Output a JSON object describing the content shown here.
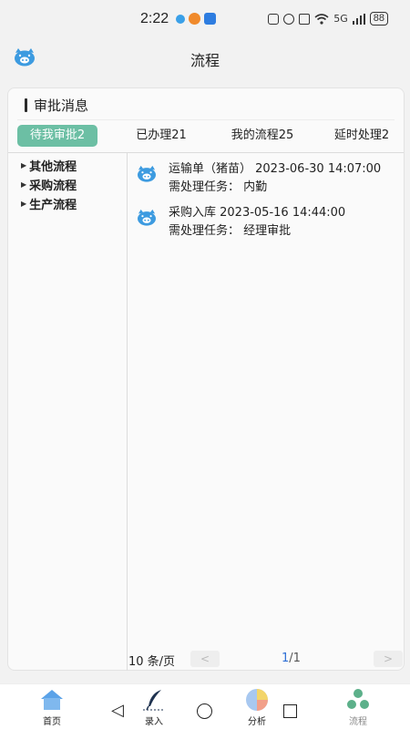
{
  "status_bar": {
    "time": "2:22",
    "battery": "88",
    "network": "5G"
  },
  "header": {
    "title": "流程"
  },
  "card": {
    "title": "审批消息",
    "tabs": [
      {
        "label": "待我审批2",
        "active": true
      },
      {
        "label": "已办理21",
        "active": false
      },
      {
        "label": "我的流程25",
        "active": false
      },
      {
        "label": "延时处理2",
        "active": false
      }
    ],
    "tree": [
      {
        "label": "其他流程"
      },
      {
        "label": "采购流程"
      },
      {
        "label": "生产流程"
      }
    ],
    "items": [
      {
        "title": "运输单（猪苗） 2023-06-30 14:07:00",
        "task": "需处理任务：  内勤"
      },
      {
        "title": "采购入库 2023-05-16 14:44:00",
        "task": "需处理任务：  经理审批"
      }
    ],
    "pager": {
      "page_size": "10 条/页",
      "prev": "<",
      "next": ">",
      "current": "1",
      "total": "/1"
    }
  },
  "bottom_nav": {
    "items": [
      {
        "label": "首页",
        "icon": "home-icon"
      },
      {
        "label": "录入",
        "icon": "feather-pen-icon"
      },
      {
        "label": "分析",
        "icon": "pie-chart-icon"
      },
      {
        "label": "流程",
        "icon": "recycle-flow-icon",
        "active": true
      }
    ]
  },
  "colors": {
    "accent": "#6cbfa4",
    "home_icon": "#5aa2e8",
    "pager_current": "#2e6fd6"
  }
}
